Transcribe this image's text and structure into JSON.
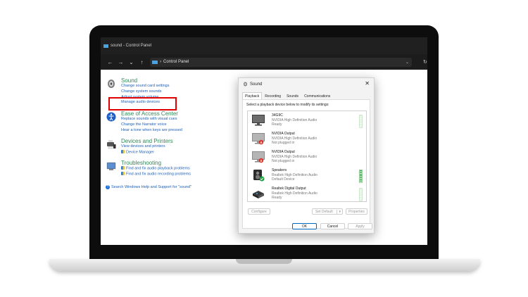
{
  "window": {
    "title": "sound - Control Panel",
    "breadcrumb": "Control Panel"
  },
  "nav": {
    "back": "←",
    "forward": "→",
    "dropdown": "⌄",
    "up": "↑",
    "separator": "›",
    "address_dropdown": "⌄",
    "refresh": "↻"
  },
  "control_panel": {
    "sections": [
      {
        "title": "Sound",
        "icon": "speaker-icon",
        "links": [
          "Change sound card settings",
          "Change system sounds",
          "Adjust system volume",
          "Manage audio devices"
        ]
      },
      {
        "title": "Ease of Access Center",
        "icon": "ease-of-access-icon",
        "links": [
          "Replace sounds with visual cues",
          "Change the Narrator voice",
          "Hear a tone when keys are pressed"
        ]
      },
      {
        "title": "Devices and Printers",
        "icon": "devices-printers-icon",
        "links": [
          "View devices and printers",
          "Device Manager"
        ]
      },
      {
        "title": "Troubleshooting",
        "icon": "troubleshooting-icon",
        "links": [
          "Find and fix audio playback problems",
          "Find and fix audio recording problems"
        ]
      }
    ],
    "help_link": "Search Windows Help and Support for \"sound\"",
    "help_icon_glyph": "?"
  },
  "dialog": {
    "title": "Sound",
    "close_glyph": "✕",
    "tabs": [
      "Playback",
      "Recording",
      "Sounds",
      "Communications"
    ],
    "active_tab": "Playback",
    "instruction": "Select a playback device below to modify its settings:",
    "devices": [
      {
        "name": "34G9C",
        "line1": "NVIDIA High Definition Audio",
        "line2": "Ready",
        "status": "ready",
        "level_active": false
      },
      {
        "name": "NVIDIA Output",
        "line1": "NVIDIA High Definition Audio",
        "line2": "Not plugged in",
        "status": "unplugged",
        "level_active": false
      },
      {
        "name": "NVIDIA Output",
        "line1": "NVIDIA High Definition Audio",
        "line2": "Not plugged in",
        "status": "unplugged",
        "level_active": false
      },
      {
        "name": "Speakers",
        "line1": "Realtek High Definition Audio",
        "line2": "Default Device",
        "status": "default",
        "level_active": true
      },
      {
        "name": "Realtek Digital Output",
        "line1": "Realtek High Definition Audio",
        "line2": "Ready",
        "status": "ready",
        "level_active": false
      }
    ],
    "buttons": {
      "configure": "Configure",
      "set_default": "Set Default",
      "set_default_arrow": "▾",
      "properties": "Properties",
      "ok": "OK",
      "cancel": "Cancel",
      "apply": "Apply"
    }
  },
  "colors": {
    "link": "#1c5fb8",
    "section_title": "#2e8b57",
    "highlight": "#e00000",
    "level_green": "#2fb34a",
    "accent_blue": "#0067c0"
  }
}
